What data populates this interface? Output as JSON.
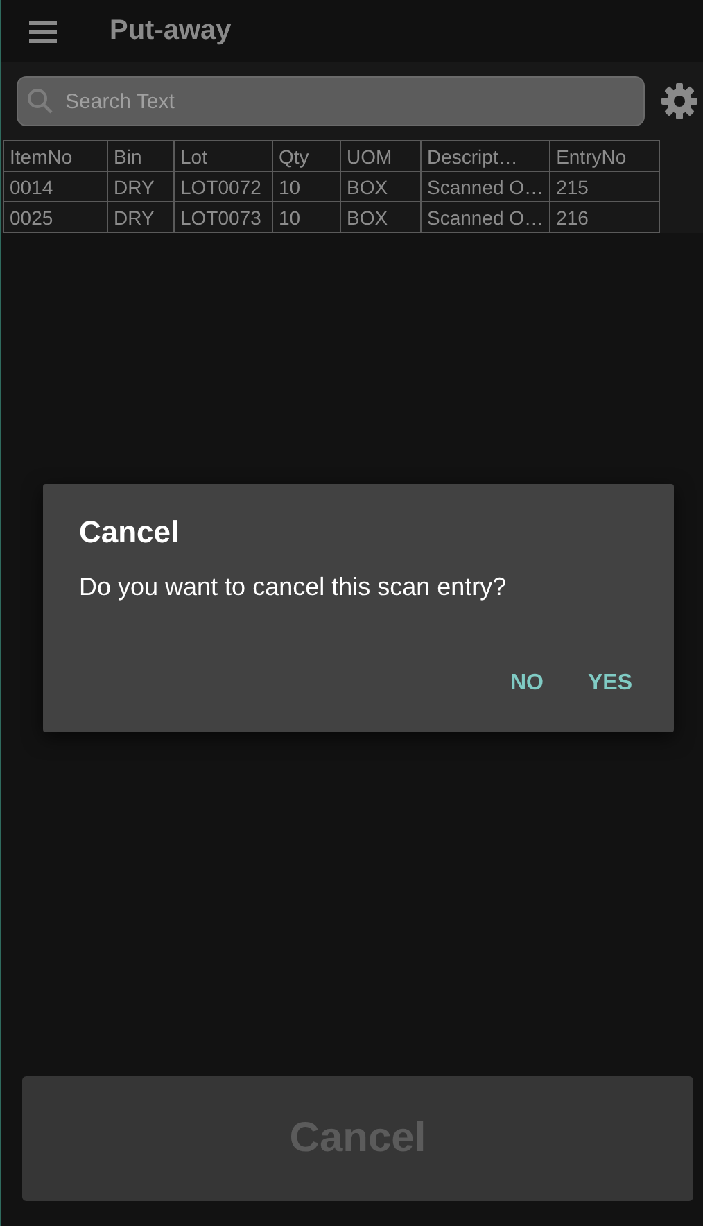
{
  "app_bar": {
    "title": "Put-away"
  },
  "search": {
    "placeholder": "Search Text"
  },
  "table": {
    "columns": [
      "ItemNo",
      "Bin",
      "Lot",
      "Qty",
      "UOM",
      "Descript…",
      "EntryNo"
    ],
    "rows": [
      [
        "0014",
        "DRY",
        "LOT0072",
        "10",
        "BOX",
        "Scanned O…",
        "215"
      ],
      [
        "0025",
        "DRY",
        "LOT0073",
        "10",
        "BOX",
        "Scanned O…",
        "216"
      ]
    ]
  },
  "dialog": {
    "title": "Cancel",
    "message": "Do you want to cancel this scan entry?",
    "buttons": [
      "NO",
      "YES"
    ]
  },
  "bottom_button": {
    "label": "Cancel",
    "disabled": true
  }
}
